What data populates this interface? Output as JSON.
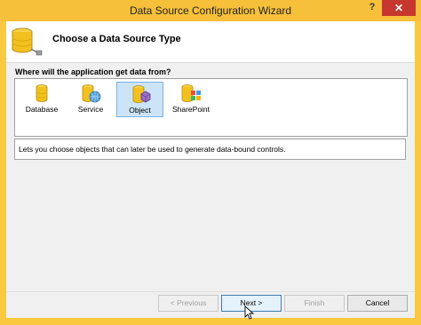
{
  "window": {
    "title": "Data Source Configuration Wizard",
    "help": "?",
    "close": "✕"
  },
  "header": {
    "title": "Choose a Data Source Type"
  },
  "question": "Where will the application get data from?",
  "gallery": {
    "items": [
      {
        "label": "Database",
        "icon": "database-icon"
      },
      {
        "label": "Service",
        "icon": "service-icon"
      },
      {
        "label": "Object",
        "icon": "object-icon",
        "selected": true
      },
      {
        "label": "SharePoint",
        "icon": "sharepoint-icon"
      }
    ]
  },
  "description": "Lets you choose objects that can later be used to generate data-bound controls.",
  "buttons": {
    "previous": "< Previous",
    "next": "Next >",
    "finish": "Finish",
    "cancel": "Cancel"
  },
  "colors": {
    "title_bar": "#f7c03a",
    "close_button": "#c7372f",
    "selection": "#cce4f7",
    "db_gold": "#f2c11f"
  }
}
